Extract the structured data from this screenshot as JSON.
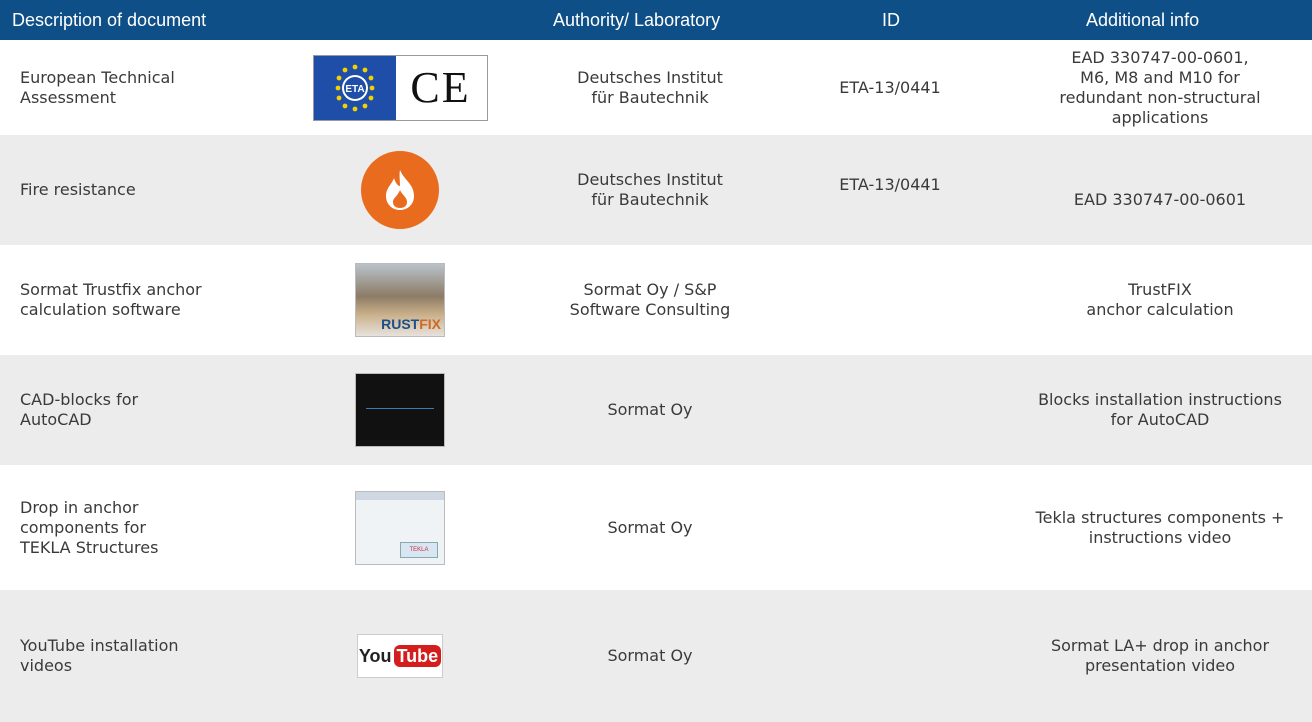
{
  "header": {
    "col_description": "Description of document",
    "col_authority": "Authority/ Laboratory",
    "col_id": "ID",
    "col_info": "Additional info"
  },
  "rows": [
    {
      "description": "European Technical\nAssessment",
      "logo": "eta-ce-logo",
      "logo_text": {
        "eta": "ETA",
        "ce": "CE"
      },
      "authority": "Deutsches Institut\nfür Bautechnik",
      "id": "ETA-13/0441",
      "info": "EAD 330747-00-0601,\nM6, M8 and M10 for\nredundant non-structural\napplications"
    },
    {
      "description": "Fire resistance",
      "logo": "fire-icon",
      "authority": "Deutsches Institut\nfür Bautechnik",
      "id": "ETA-13/0441",
      "info": "EAD 330747-00-0601"
    },
    {
      "description": "Sormat Trustfix anchor\ncalculation software",
      "logo": "trustfix-thumbnail",
      "logo_text": {
        "trust": "RUST",
        "fix": "FIX"
      },
      "authority": "Sormat Oy / S&P\nSoftware Consulting",
      "id": "",
      "info": "TrustFIX\nanchor calculation"
    },
    {
      "description": "CAD-blocks for\nAutoCAD",
      "logo": "autocad-thumbnail",
      "authority": "Sormat Oy",
      "id": "",
      "info": "Blocks installation instructions\nfor AutoCAD"
    },
    {
      "description": "Drop in anchor\ncomponents for\nTEKLA Structures",
      "logo": "tekla-thumbnail",
      "logo_text": {
        "tekla": "TEKLA"
      },
      "authority": "Sormat Oy",
      "id": "",
      "info": "Tekla structures components +\ninstructions video"
    },
    {
      "description": "YouTube installation\nvideos",
      "logo": "youtube-logo",
      "logo_text": {
        "you": "You",
        "tube": "Tube"
      },
      "authority": "Sormat Oy",
      "id": "",
      "info": "Sormat LA+ drop in anchor\npresentation video"
    }
  ],
  "colors": {
    "header_bg": "#0d4f86",
    "alt_row_bg": "#ececec",
    "fire_orange": "#e96b1e",
    "eu_blue": "#1e4ea8",
    "youtube_red": "#d41e1e"
  }
}
